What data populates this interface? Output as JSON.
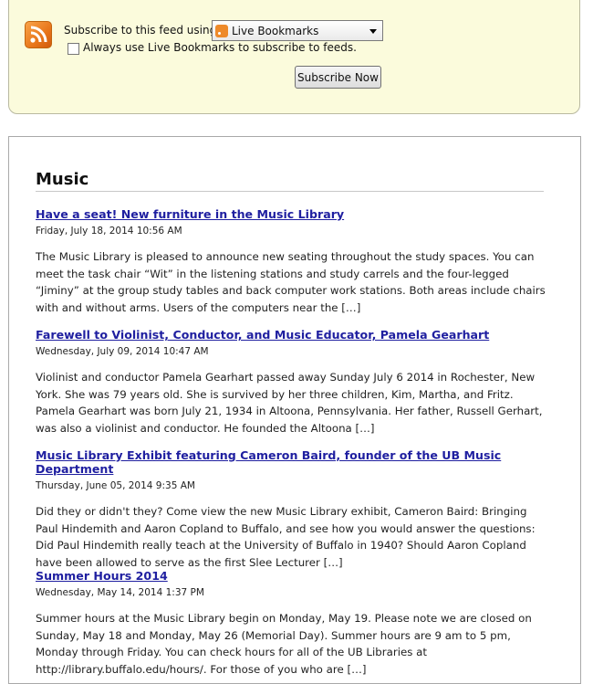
{
  "subscribe": {
    "label": "Subscribe to this feed using",
    "reader_selected": "Live Bookmarks",
    "always_use_label": "Always use Live Bookmarks to subscribe to feeds.",
    "always_use_checked": false,
    "button_label": "Subscribe Now"
  },
  "feed": {
    "title": "Music",
    "entries": [
      {
        "title": "Have a seat! New furniture in the Music Library",
        "date": "Friday, July 18, 2014 10:56 AM",
        "summary": "The Music Library is pleased to announce new seating throughout the study spaces. You can meet the task chair “Wit” in the listening stations and study carrels and the four-legged “Jiminy” at the group study tables and back computer work stations. Both areas include chairs with and without arms. Users of the computers near the […]"
      },
      {
        "title": "Farewell to Violinist, Conductor, and Music Educator, Pamela Gearhart",
        "date": "Wednesday, July 09, 2014 10:47 AM",
        "summary": "Violinist and conductor Pamela Gearhart passed away Sunday July 6 2014 in Rochester, New York. She was 79 years old. She is survived by her three children, Kim, Martha, and Fritz. Pamela Gearhart was born July 21, 1934 in Altoona, Pennsylvania. Her father, Russell Gerhart, was also a violinist and conductor. He founded the Altoona […]"
      },
      {
        "title": "Music Library Exhibit featuring Cameron Baird, founder of the UB Music Department",
        "date": "Thursday, June 05, 2014 9:35 AM",
        "summary": "Did they or didn't they? Come view the new Music Library exhibit, Cameron Baird: Bringing Paul Hindemith and Aaron Copland to Buffalo, and see how you would answer the questions: Did Paul Hindemith really teach at the University of Buffalo in 1940? Should Aaron Copland have been allowed to serve as the first Slee Lecturer […]"
      },
      {
        "title": "Summer Hours 2014",
        "date": "Wednesday, May 14, 2014 1:37 PM",
        "summary": "Summer hours at the Music Library begin on Monday, May 19. Please note we are closed on Sunday, May 18 and Monday, May 26 (Memorial Day). Summer hours are 9 am to 5 pm, Monday through Friday. You can check hours for all of the UB Libraries at http://library.buffalo.edu/hours/. For those of you who are […]"
      }
    ]
  }
}
